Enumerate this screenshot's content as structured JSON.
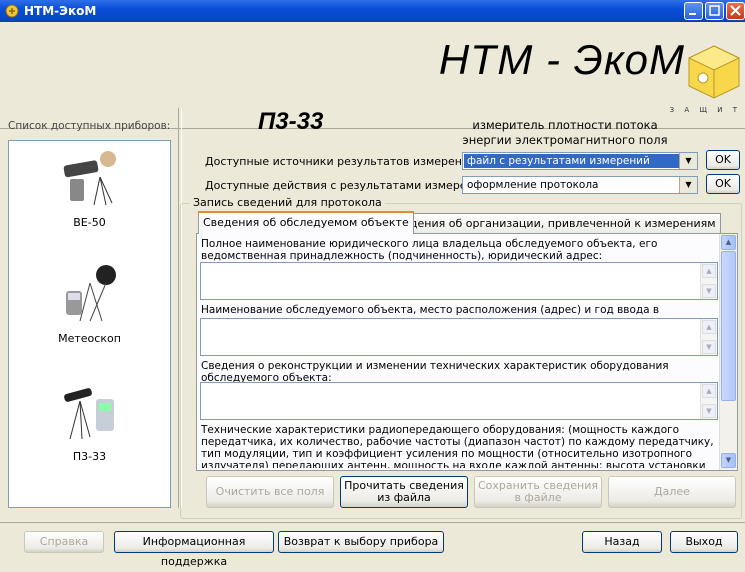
{
  "window": {
    "title": "НТМ-ЭкоМ"
  },
  "header": {
    "brand": "НТМ - ЭкоМ",
    "logo_caption": "З А Щ И Т"
  },
  "left": {
    "list_label": "Список доступных приборов:",
    "devices": [
      {
        "label": "ВЕ-50"
      },
      {
        "label": "Метеоскоп"
      },
      {
        "label": "П3-33"
      }
    ]
  },
  "device": {
    "title": "П3-33",
    "description": "измеритель плотности потока энергии электромагнитного поля"
  },
  "sources": {
    "label": "Доступные источники результатов измерений:",
    "value": "файл с результатами измерений",
    "ok": "OK"
  },
  "actions": {
    "label": "Доступные действия с результатами измерений:",
    "value": "оформление протокола",
    "ok": "OK"
  },
  "protocol": {
    "group_title": "Запись сведений для протокола",
    "tabs": [
      {
        "label": "Сведения об обследуемом объекте"
      },
      {
        "label": "Сведения об организации, привлеченной к измерениям"
      }
    ],
    "fields": [
      {
        "label": "Полное наименование юридического лица владельца обследуемого объекта, его ведомственная принадлежность (подчиненность), юридический адрес:"
      },
      {
        "label": "Наименование обследуемого объекта, место расположения (адрес) и год ввода в эксплуатацию:"
      },
      {
        "label": "Сведения о реконструкции и изменении технических характеристик оборудования обследуемого объекта:"
      },
      {
        "label": "Технические характеристики радиопередающего оборудования: (мощность каждого передатчика, их количество, рабочие частоты (диапазон частот) по каждому передатчику, тип модуляции, тип и коэффициент усиления по мощности (относительно изотропного излучателя) передающих антенн, мощность на входе каждой антенны; высота установки антенн от поверхности земли и от опорной поверхности (крыши); угол максимума диаграммы и диаграммы направленности в горизонтальной и"
      }
    ],
    "buttons": {
      "clear": "Очистить все поля",
      "read_line1": "Прочитать сведения",
      "read_line2": "из файла",
      "save_line1": "Сохранить сведения",
      "save_line2": "в файле",
      "next": "Далее"
    }
  },
  "footer": {
    "help": "Справка",
    "support": "Информационная поддержка",
    "back_to_device": "Возврат к выбору прибора",
    "back": "Назад",
    "exit": "Выход"
  }
}
